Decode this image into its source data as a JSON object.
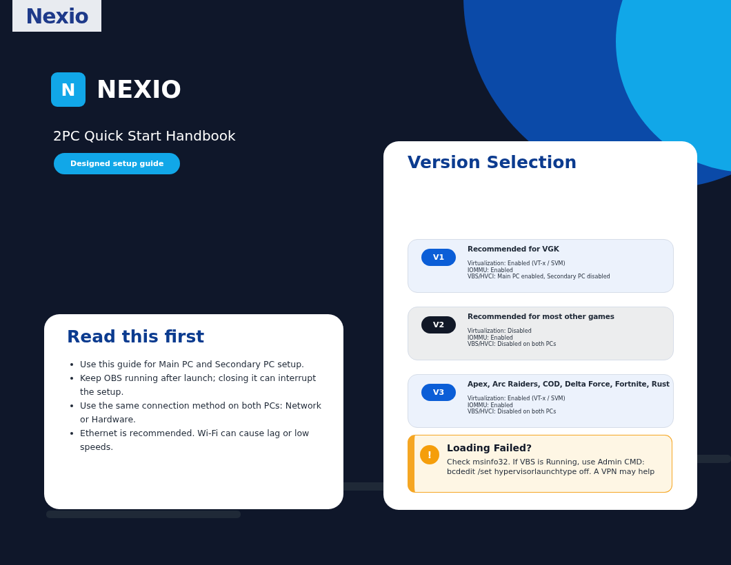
{
  "logo": "Nexio",
  "brand": {
    "mark": "N",
    "name": "NEXIO"
  },
  "subtitle": "2PC Quick Start Handbook",
  "tag": "Designed setup guide",
  "read_first": {
    "title": "Read this first",
    "items": [
      "Use this guide for Main PC and Secondary PC setup.",
      "Keep OBS running after launch; closing it can interrupt the setup.",
      "Use the same connection method on both PCs: Network or Hardware.",
      "Ethernet is recommended. Wi-Fi can cause lag or low speeds."
    ]
  },
  "version_selection": {
    "title": "Version Selection",
    "versions": [
      {
        "badge": "V1",
        "color": "#0b5ed7",
        "title": "Recommended for VGK",
        "lines": [
          "Virtualization: Enabled (VT-x / SVM)",
          "IOMMU: Enabled",
          "VBS/HVCI: Main PC enabled, Secondary PC disabled"
        ]
      },
      {
        "badge": "V2",
        "color": "#111827",
        "title": "Recommended for most other games",
        "lines": [
          "Virtualization: Disabled",
          "IOMMU: Enabled",
          "VBS/HVCI: Disabled on both PCs"
        ]
      },
      {
        "badge": "V3",
        "color": "#0b5ed7",
        "title": "Apex, Arc Raiders, COD, Delta Force, Fortnite, Rust",
        "lines": [
          "Virtualization: Enabled (VT-x / SVM)",
          "IOMMU: Enabled",
          "VBS/HVCI: Disabled on both PCs"
        ]
      }
    ],
    "warning": {
      "icon": "!",
      "title": "Loading Failed?",
      "text": "Check msinfo32. If VBS is Running, use Admin CMD: bcdedit /set hypervisorlaunchtype off. A VPN may help"
    }
  }
}
